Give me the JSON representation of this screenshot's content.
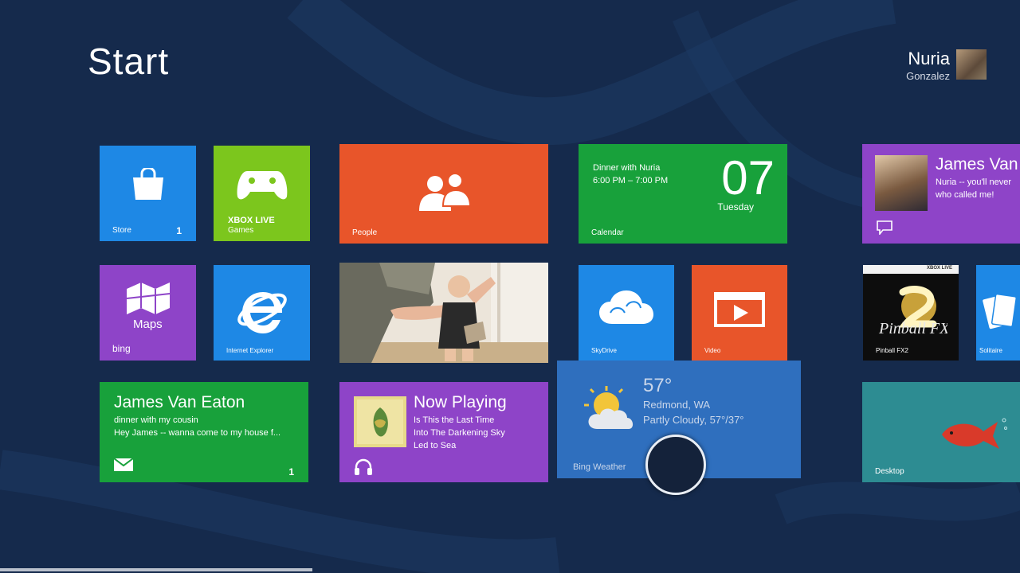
{
  "header": {
    "title": "Start"
  },
  "user": {
    "first_name": "Nuria",
    "last_name": "Gonzalez"
  },
  "tiles": {
    "store": {
      "label": "Store",
      "badge": "1"
    },
    "xbox": {
      "brand": "XBOX LIVE",
      "label": "Games"
    },
    "people": {
      "label": "People"
    },
    "calendar": {
      "event_title": "Dinner with Nuria",
      "event_time": "6:00 PM – 7:00 PM",
      "day_number": "07",
      "day_name": "Tuesday",
      "label": "Calendar"
    },
    "messaging": {
      "name": "James Van",
      "line1": "Nuria -- you'll never",
      "line2": "who called me!"
    },
    "maps": {
      "title": "Maps",
      "brand": "bing"
    },
    "ie": {
      "label": "Internet Explorer"
    },
    "skydrive": {
      "label": "SkyDrive"
    },
    "video": {
      "label": "Video"
    },
    "pinball": {
      "brand": "XBOX LIVE",
      "label": "Pinball FX2"
    },
    "solitaire": {
      "label": "Solitaire"
    },
    "mail": {
      "sender": "James Van Eaton",
      "subject": "dinner with my cousin",
      "preview": "Hey James -- wanna come to my house f...",
      "badge": "1"
    },
    "music": {
      "title": "Now Playing",
      "line1": "Is This the Last Time",
      "line2": "Into The Darkening Sky",
      "line3": "Led to Sea"
    },
    "weather": {
      "temperature": "57°",
      "location": "Redmond, WA",
      "condition": "Partly Cloudy, 57°/37°",
      "label": "Bing Weather"
    },
    "desktop": {
      "label": "Desktop"
    }
  },
  "colors": {
    "background": "#152a4c",
    "store": "#1e88e5",
    "xbox": "#7cc61d",
    "people": "#e8552a",
    "calendar": "#18a13b",
    "messaging": "#8e44c8",
    "maps": "#8e44c8",
    "ie": "#1e88e5",
    "skydrive": "#1e88e5",
    "video": "#e8552a",
    "mail": "#18a13b",
    "music": "#8e44c8",
    "weather": "#2f6fbe",
    "desktop": "#2d8c92"
  }
}
